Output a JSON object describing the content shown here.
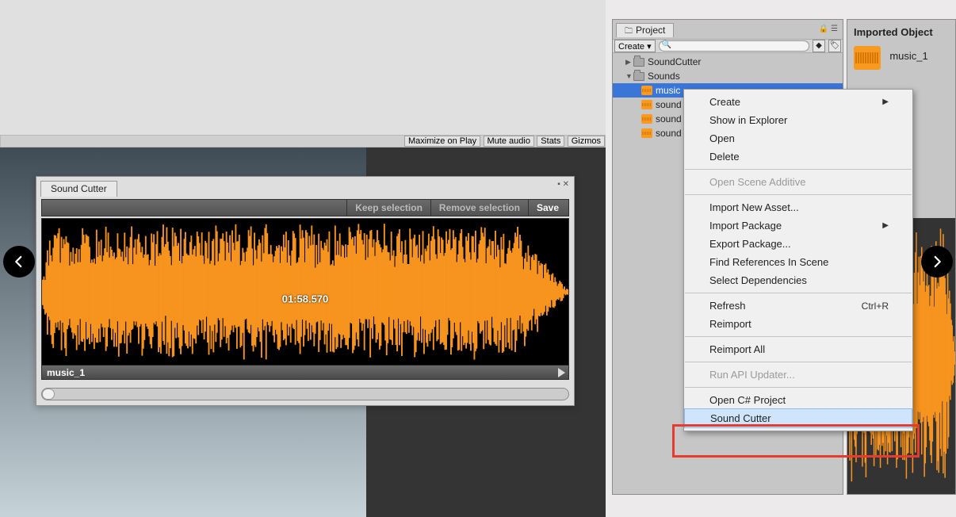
{
  "scene_toolbar": {
    "maximize": "Maximize on Play",
    "mute": "Mute audio",
    "stats": "Stats",
    "gizmos": "Gizmos"
  },
  "sound_cutter": {
    "tab_title": "Sound Cutter",
    "keep": "Keep selection",
    "remove": "Remove selection",
    "save": "Save",
    "timecode": "01:58.570",
    "clip_name": "music_1"
  },
  "project": {
    "tab_label": "Project",
    "create_label": "Create",
    "search_placeholder": "",
    "tree": {
      "root1": "SoundCutter",
      "root2": "Sounds",
      "children": [
        "music",
        "sound",
        "sound",
        "sound"
      ]
    }
  },
  "context_menu": {
    "items": [
      {
        "label": "Create",
        "submenu": true
      },
      {
        "label": "Show in Explorer"
      },
      {
        "label": "Open"
      },
      {
        "label": "Delete"
      },
      {
        "sep": true
      },
      {
        "label": "Open Scene Additive",
        "disabled": true
      },
      {
        "sep": true
      },
      {
        "label": "Import New Asset..."
      },
      {
        "label": "Import Package",
        "submenu": true
      },
      {
        "label": "Export Package..."
      },
      {
        "label": "Find References In Scene"
      },
      {
        "label": "Select Dependencies"
      },
      {
        "sep": true
      },
      {
        "label": "Refresh",
        "shortcut": "Ctrl+R"
      },
      {
        "label": "Reimport"
      },
      {
        "sep": true
      },
      {
        "label": "Reimport All"
      },
      {
        "sep": true
      },
      {
        "label": "Run API Updater...",
        "disabled": true
      },
      {
        "sep": true
      },
      {
        "label": "Open C# Project"
      },
      {
        "label": "Sound Cutter",
        "highlight": true
      }
    ]
  },
  "inspector": {
    "title": "Imported Object",
    "asset_name": "music_1"
  }
}
